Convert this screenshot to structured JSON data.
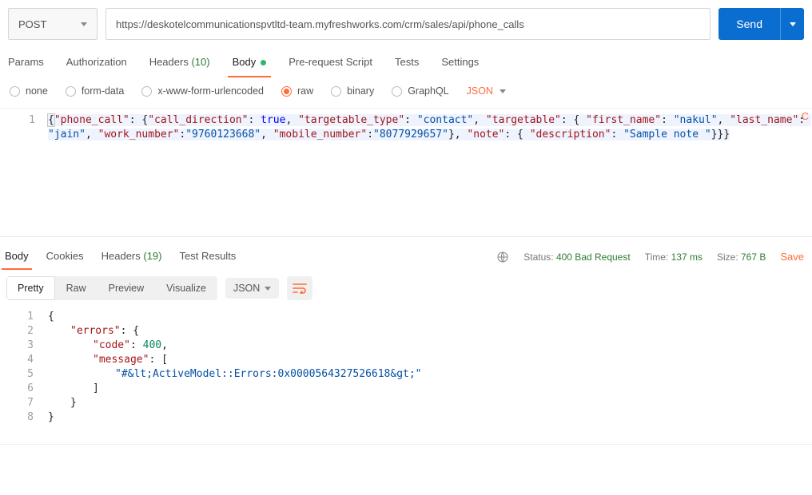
{
  "request": {
    "method": "POST",
    "url": "https://deskotelcommunicationspvtltd-team.myfreshworks.com/crm/sales/api/phone_calls",
    "send_label": "Send"
  },
  "tabs": {
    "params": "Params",
    "authorization": "Authorization",
    "headers": "Headers",
    "headers_count": "(10)",
    "body": "Body",
    "prerequest": "Pre-request Script",
    "tests": "Tests",
    "settings": "Settings",
    "cutoff_char": "C"
  },
  "body_radios": {
    "none": "none",
    "formdata": "form-data",
    "xform": "x-www-form-urlencoded",
    "raw": "raw",
    "binary": "binary",
    "graphql": "GraphQL",
    "type": "JSON"
  },
  "request_body_line_numbers": [
    "1"
  ],
  "request_body_tokens": [
    {
      "t": "p",
      "v": "{"
    },
    {
      "t": "k",
      "v": "\"phone_call\""
    },
    {
      "t": "p",
      "v": ": {"
    },
    {
      "t": "k",
      "v": "\"call_direction\""
    },
    {
      "t": "p",
      "v": ": "
    },
    {
      "t": "b",
      "v": "true"
    },
    {
      "t": "p",
      "v": ", "
    },
    {
      "t": "k",
      "v": "\"targetable_type\""
    },
    {
      "t": "p",
      "v": ": "
    },
    {
      "t": "s",
      "v": "\"contact\""
    },
    {
      "t": "p",
      "v": ", "
    },
    {
      "t": "k",
      "v": "\"targetable\""
    },
    {
      "t": "p",
      "v": ": { "
    },
    {
      "t": "k",
      "v": "\"first_name\""
    },
    {
      "t": "p",
      "v": ": "
    },
    {
      "t": "s",
      "v": "\"nakul\""
    },
    {
      "t": "p",
      "v": ", "
    },
    {
      "t": "k",
      "v": "\"last_name\""
    },
    {
      "t": "p",
      "v": ": "
    },
    {
      "t": "s",
      "v": "\"jain\""
    },
    {
      "t": "p",
      "v": ", "
    },
    {
      "t": "k",
      "v": "\"work_number\""
    },
    {
      "t": "p",
      "v": ":"
    },
    {
      "t": "s",
      "v": "\"9760123668\""
    },
    {
      "t": "p",
      "v": ", "
    },
    {
      "t": "k",
      "v": "\"mobile_number\""
    },
    {
      "t": "p",
      "v": ":"
    },
    {
      "t": "s",
      "v": "\"8077929657\""
    },
    {
      "t": "p",
      "v": "}, "
    },
    {
      "t": "k",
      "v": "\"note\""
    },
    {
      "t": "p",
      "v": ": { "
    },
    {
      "t": "k",
      "v": "\"description\""
    },
    {
      "t": "p",
      "v": ": "
    },
    {
      "t": "s",
      "v": "\"Sample note \""
    },
    {
      "t": "p",
      "v": "}}}"
    }
  ],
  "response_tabs": {
    "body": "Body",
    "cookies": "Cookies",
    "headers": "Headers",
    "headers_count": "(19)",
    "testresults": "Test Results"
  },
  "response_meta": {
    "status_label": "Status:",
    "status_value": "400 Bad Request",
    "time_label": "Time:",
    "time_value": "137 ms",
    "size_label": "Size:",
    "size_value": "767 B",
    "save": "Save"
  },
  "viewbar": {
    "pretty": "Pretty",
    "raw": "Raw",
    "preview": "Preview",
    "visualize": "Visualize",
    "type": "JSON"
  },
  "response_lines": [
    "1",
    "2",
    "3",
    "4",
    "5",
    "6",
    "7",
    "8"
  ],
  "response_code": {
    "l1": "{",
    "l2_key": "\"errors\"",
    "l2_rest": ": {",
    "l3_key": "\"code\"",
    "l3_val": "400",
    "l4_key": "\"message\"",
    "l4_rest": ": [",
    "l5_val": "\"#&lt;ActiveModel::Errors:0x0000564327526618&gt;\"",
    "l6": "]",
    "l7": "}",
    "l8": "}"
  }
}
